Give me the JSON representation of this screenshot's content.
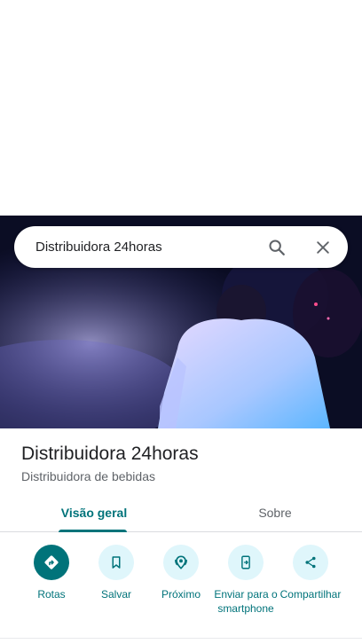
{
  "search": {
    "query": "Distribuidora 24horas"
  },
  "place": {
    "name": "Distribuidora 24horas",
    "category": "Distribuidora de bebidas"
  },
  "tabs": [
    {
      "label": "Visão geral",
      "active": true
    },
    {
      "label": "Sobre",
      "active": false
    }
  ],
  "actions": [
    {
      "label": "Rotas",
      "icon": "directions-icon"
    },
    {
      "label": "Salvar",
      "icon": "bookmark-icon"
    },
    {
      "label": "Próximo",
      "icon": "nearby-icon"
    },
    {
      "label": "Enviar para o smartphone",
      "icon": "send-to-phone-icon"
    },
    {
      "label": "Compartilhar",
      "icon": "share-icon"
    }
  ],
  "colors": {
    "accent": "#00737a",
    "accent_light": "#dff6fb",
    "text": "#202124",
    "secondary_text": "#5f6368"
  }
}
